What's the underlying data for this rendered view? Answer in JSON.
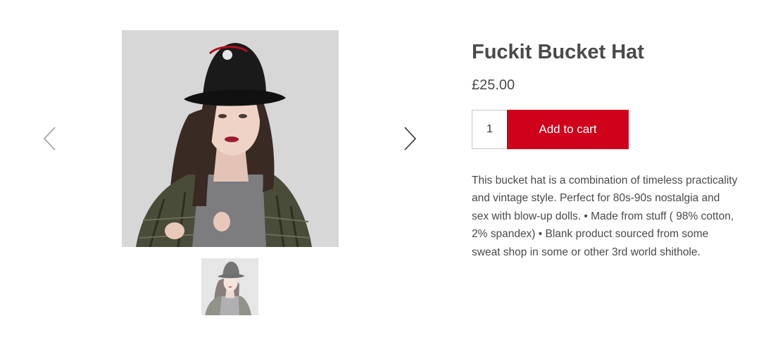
{
  "product": {
    "title": "Fuckit Bucket Hat",
    "price": "£25.00",
    "quantity": "1",
    "add_to_cart_label": "Add to cart",
    "description": "This bucket hat is a combination of timeless practicality and vintage style. Perfect for 80s-90s nostalgia and sex with blow-up dolls. • Made from stuff ( 98% cotton, 2% spandex) • Blank product sourced from some sweat shop in some or other 3rd world shithole."
  },
  "gallery": {
    "prev_icon": "chevron-left-icon",
    "next_icon": "chevron-right-icon",
    "image_subject": "woman wearing black bucket hat and plaid shirt",
    "thumbnail_count": 1
  },
  "colors": {
    "accent": "#d0011b",
    "text": "#4a4a4a",
    "image_background": "#dcdcdc"
  }
}
